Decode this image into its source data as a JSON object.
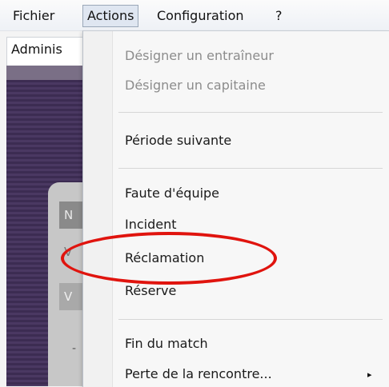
{
  "menubar": {
    "items": [
      "Fichier",
      "Actions",
      "Configuration",
      "?"
    ]
  },
  "window": {
    "tab_label": "Adminis"
  },
  "background": {
    "card_rows": [
      "N",
      "V",
      "V"
    ],
    "card_dot": "-"
  },
  "actions_menu": {
    "items": [
      {
        "label": "Désigner un entraîneur",
        "enabled": false
      },
      {
        "label": "Désigner un capitaine",
        "enabled": false
      },
      {
        "label": "Période suivante",
        "enabled": true
      },
      {
        "label": "Faute d'équipe",
        "enabled": true
      },
      {
        "label": "Incident",
        "enabled": true
      },
      {
        "label": "Réclamation",
        "enabled": true
      },
      {
        "label": "Réserve",
        "enabled": true
      },
      {
        "label": "Fin du match",
        "enabled": true
      },
      {
        "label": "Perte de la rencontre...",
        "enabled": true,
        "submenu": true
      }
    ],
    "submenu_arrow": "▸",
    "highlighted_item": "Réclamation",
    "highlight_color": "#e0140e"
  }
}
